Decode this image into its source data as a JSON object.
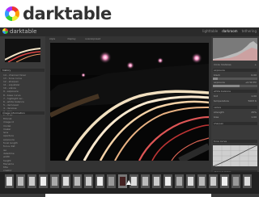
{
  "banner": {
    "logo_text": "darktable"
  },
  "app": {
    "name": "darktable",
    "views": [
      "lighttable",
      "darkroom",
      "tethering"
    ],
    "active_view": "darkroom"
  },
  "left_panel": {
    "navigation_header": "navigation",
    "history_header": "history",
    "history_items": [
      "14 - channel mixer",
      "13 - tone curve",
      "12 - sharpen",
      "11 - equalizer",
      "10 - velvia",
      "9 - exposure",
      "8 - base curve",
      "7 - highlight rec.",
      "6 - white balance",
      "5 - demosaic",
      "4 - denoise",
      "3 - lens",
      "2 - crop",
      "1 - original"
    ],
    "image_info_header": "image information",
    "meta_labels": [
      "filmroll",
      "image id",
      "model",
      "maker",
      "lens",
      "aperture",
      "exposure",
      "focal length",
      "focus dist",
      "iso",
      "datetime",
      "width",
      "height",
      "filename",
      "title",
      "creator",
      "rights"
    ]
  },
  "center": {
    "toolbar_items": [
      "style",
      "display",
      "overexposed"
    ]
  },
  "right_panel": {
    "rows": [
      {
        "label": "more modules",
        "value": "+"
      },
      {
        "label": "exposure",
        "value": ""
      },
      {
        "label": "black",
        "value": "0.00"
      },
      {
        "label": "exposure",
        "value": "+0.50 EV"
      },
      {
        "label": "white balance",
        "value": ""
      },
      {
        "label": "tint",
        "value": "1.00"
      },
      {
        "label": "temperature",
        "value": "5003 K"
      },
      {
        "label": "velvia",
        "value": ""
      },
      {
        "label": "strength",
        "value": "25%"
      },
      {
        "label": "bias",
        "value": "1.00"
      },
      {
        "label": "sharpen",
        "value": ""
      },
      {
        "label": "tone curve",
        "value": ""
      },
      {
        "label": "channel mixer",
        "value": ""
      },
      {
        "label": "output color",
        "value": ""
      },
      {
        "label": "gamma",
        "value": ""
      }
    ]
  },
  "colors": {
    "accent": "#e44",
    "panel": "#3a3a3a",
    "background": "#333333"
  }
}
